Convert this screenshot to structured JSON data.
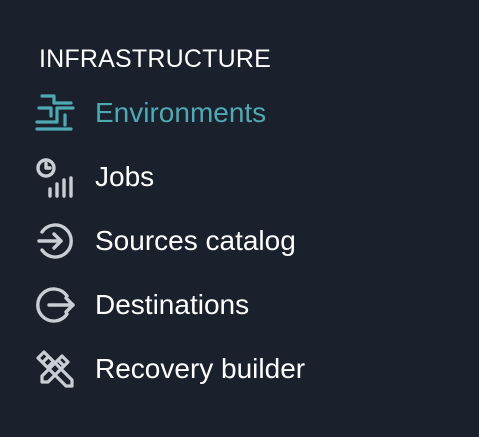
{
  "sidebar": {
    "section_title": "INFRASTRUCTURE",
    "items": [
      {
        "label": "Environments",
        "icon": "environments-icon",
        "active": true
      },
      {
        "label": "Jobs",
        "icon": "jobs-icon",
        "active": false
      },
      {
        "label": "Sources catalog",
        "icon": "sources-icon",
        "active": false
      },
      {
        "label": "Destinations",
        "icon": "destinations-icon",
        "active": false
      },
      {
        "label": "Recovery builder",
        "icon": "recovery-builder-icon",
        "active": false
      }
    ]
  },
  "colors": {
    "background": "#1a202c",
    "active": "#4fa9b3",
    "text": "#ffffff",
    "icon": "#c9ced6"
  }
}
